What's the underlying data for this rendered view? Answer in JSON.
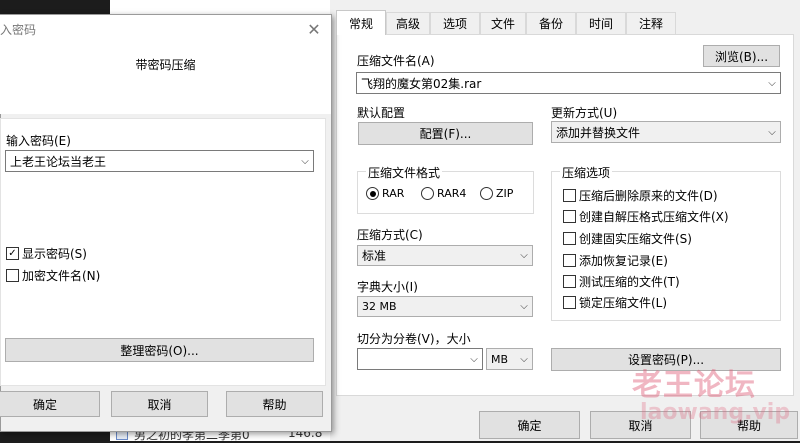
{
  "background": {
    "filename_snippet": "男之初的孝第二季第0",
    "size_snippet": "146.8"
  },
  "password_dialog": {
    "title": "输入密码",
    "header": "带密码压缩",
    "password_label": "输入密码(E)",
    "password_value": "上老王论坛当老王",
    "show_password_label": "显示密码(S)",
    "show_password_checked": true,
    "encrypt_filenames_label": "加密文件名(N)",
    "encrypt_filenames_checked": false,
    "organize_button": "整理密码(O)...",
    "ok_button": "确定",
    "cancel_button": "取消",
    "help_button": "帮助"
  },
  "archive_dialog": {
    "tabs": [
      "常规",
      "高级",
      "选项",
      "文件",
      "备份",
      "时间",
      "注释"
    ],
    "active_tab": 0,
    "archive_name_label": "压缩文件名(A)",
    "browse_button": "浏览(B)...",
    "archive_name_value": "飞翔的魔女第02集.rar",
    "default_profile_label": "默认配置",
    "profile_button": "配置(F)...",
    "update_mode_label": "更新方式(U)",
    "update_mode_value": "添加并替换文件",
    "format_group_label": "压缩文件格式",
    "formats": [
      {
        "label": "RAR",
        "selected": true
      },
      {
        "label": "RAR4",
        "selected": false
      },
      {
        "label": "ZIP",
        "selected": false
      }
    ],
    "options_group_label": "压缩选项",
    "options": [
      {
        "label": "压缩后删除原来的文件(D)",
        "checked": false
      },
      {
        "label": "创建自解压格式压缩文件(X)",
        "checked": false
      },
      {
        "label": "创建固实压缩文件(S)",
        "checked": false
      },
      {
        "label": "添加恢复记录(E)",
        "checked": false
      },
      {
        "label": "测试压缩的文件(T)",
        "checked": false
      },
      {
        "label": "锁定压缩文件(L)",
        "checked": false
      }
    ],
    "method_label": "压缩方式(C)",
    "method_value": "标准",
    "dict_label": "字典大小(I)",
    "dict_value": "32 MB",
    "split_label": "切分为分卷(V)，大小",
    "split_value": "",
    "split_unit": "MB",
    "set_password_button": "设置密码(P)...",
    "ok_button": "确定",
    "cancel_button": "取消",
    "help_button": "帮助"
  },
  "watermark": {
    "text": "老王论坛",
    "url": "laowang.vip",
    "color": "#e0607a"
  }
}
